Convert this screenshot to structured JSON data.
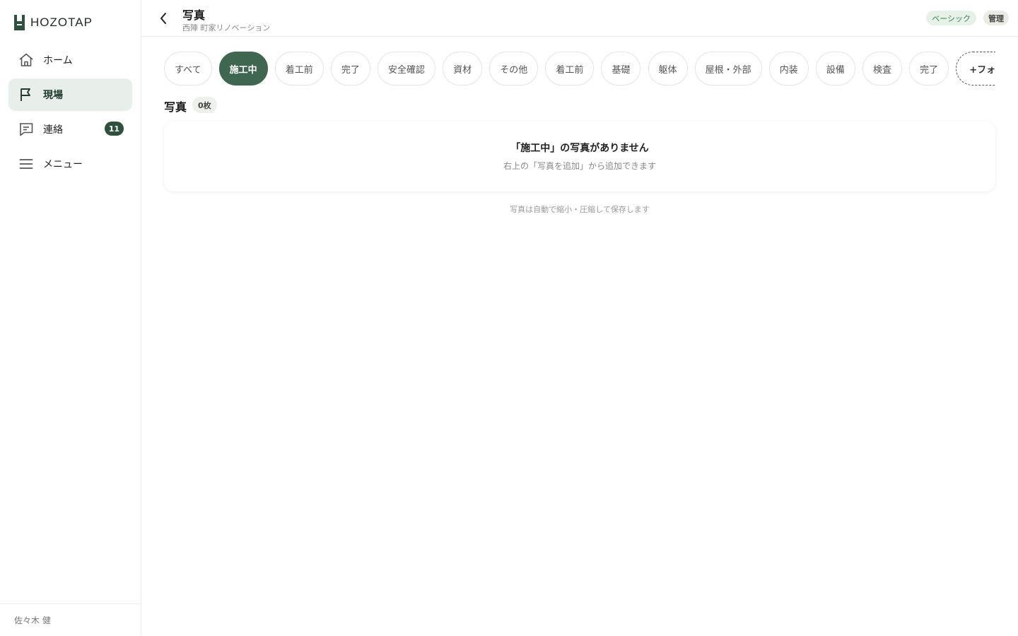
{
  "app": {
    "name": "HOZOTAP"
  },
  "sidebar": {
    "items": [
      {
        "label": "ホーム",
        "icon": "home-icon"
      },
      {
        "label": "現場",
        "icon": "flag-icon",
        "active": true
      },
      {
        "label": "連絡",
        "icon": "message-icon",
        "badge": "11"
      },
      {
        "label": "メニュー",
        "icon": "menu-icon"
      }
    ],
    "user_name": "佐々木 健"
  },
  "header": {
    "title": "写真",
    "subtitle": "西陣 町家リノベーション",
    "plan_label": "ベーシック",
    "admin_label": "管理"
  },
  "folders": {
    "items": [
      "すべて",
      "施工中",
      "着工前",
      "完了",
      "安全確認",
      "資材",
      "その他",
      "着工前",
      "基礎",
      "躯体",
      "屋根・外部",
      "内装",
      "設備",
      "検査",
      "完了"
    ],
    "active": "施工中",
    "add_label": "+フォルダ"
  },
  "photos": {
    "section_title": "写真",
    "count": "0枚",
    "empty_title": "「施工中」の写真がありません",
    "empty_hint": "右上の「写真を追加」から追加できます",
    "footnote": "写真は自動で縮小・圧縮して保存します"
  },
  "colors": {
    "accent": "#3f6650",
    "accent_dark": "#2f4f3f",
    "active_nav_bg": "#e8eee9",
    "plan_pill_bg": "#e6f1e8",
    "plan_pill_text": "#3f7f52"
  }
}
